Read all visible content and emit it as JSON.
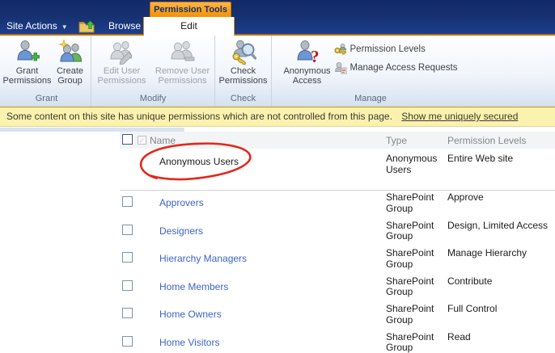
{
  "colors": {
    "navy_bar": "#16306f",
    "contextual_orange": "#ef9000",
    "statusbar_bg": "#fbf2ae",
    "link_blue": "#3c63c6",
    "annotation_red": "#e2281c"
  },
  "chrome": {
    "site_actions_label": "Site Actions",
    "contextual_tools_label": "Permission Tools",
    "tabs": [
      {
        "label": "Browse"
      },
      {
        "label": "Edit"
      }
    ]
  },
  "ribbon": {
    "groups": [
      {
        "label": "Grant",
        "buttons": [
          {
            "label": "Grant\nPermissions"
          },
          {
            "label": "Create\nGroup"
          }
        ]
      },
      {
        "label": "Modify",
        "buttons": [
          {
            "label": "Edit User\nPermissions"
          },
          {
            "label": "Remove User\nPermissions"
          }
        ]
      },
      {
        "label": "Check",
        "buttons": [
          {
            "label": "Check\nPermissions"
          }
        ]
      },
      {
        "label": "Manage",
        "large": {
          "label": "Anonymous\nAccess"
        },
        "small": [
          {
            "label": "Permission Levels"
          },
          {
            "label": "Manage Access Requests"
          }
        ]
      }
    ]
  },
  "statusbar": {
    "message": "Some content on this site has unique permissions which are not controlled from this page.",
    "link_label": "Show me uniquely secured"
  },
  "table": {
    "headers": {
      "name": "Name",
      "type": "Type",
      "permission": "Permission Levels"
    },
    "rows": [
      {
        "name": "Anonymous Users",
        "type": "Anonymous Users",
        "permission": "Entire Web site"
      },
      {
        "name": "Approvers",
        "type": "SharePoint Group",
        "permission": "Approve"
      },
      {
        "name": "Designers",
        "type": "SharePoint Group",
        "permission": "Design, Limited Access"
      },
      {
        "name": "Hierarchy Managers",
        "type": "SharePoint Group",
        "permission": "Manage Hierarchy"
      },
      {
        "name": "Home Members",
        "type": "SharePoint Group",
        "permission": "Contribute"
      },
      {
        "name": "Home Owners",
        "type": "SharePoint Group",
        "permission": "Full Control"
      },
      {
        "name": "Home Visitors",
        "type": "SharePoint Group",
        "permission": "Read"
      }
    ]
  },
  "annotation": {
    "circled_text": "Anonymous Users"
  }
}
